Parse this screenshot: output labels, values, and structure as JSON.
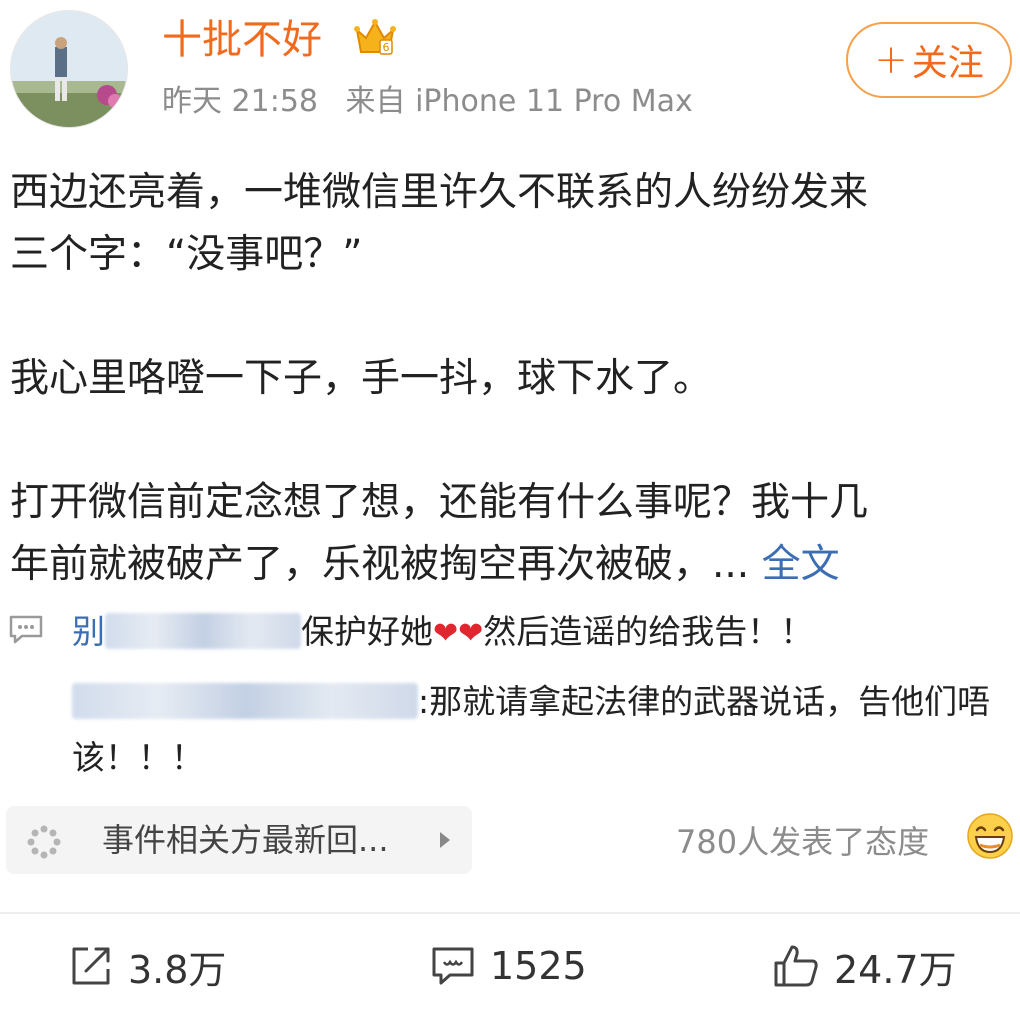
{
  "header": {
    "username": "十批不好",
    "time": "昨天 21:58",
    "source": "来自 iPhone 11 Pro Max",
    "follow_label": "关注",
    "follow_plus": "+"
  },
  "post": {
    "lines": [
      "西边还亮着，一堆微信里许久不联系的人纷纷发来",
      "三个字：“没事吧？”",
      "我心里咯噔一下子，手一抖，球下水了。",
      "打开微信前定念想了想，还能有什么事呢？我十几",
      "年前就被破产了，乐视被掏空再次被破，..."
    ],
    "full_text_link": "全文"
  },
  "comments": [
    {
      "author_prefix": "别",
      "text_before": "保护好她",
      "hearts": [
        "❤",
        "❤"
      ],
      "text_after": "然后造谣的给我告！！"
    },
    {
      "text": ":那就请拿起法律的武器说话，告他们唔该！！！"
    }
  ],
  "topic": {
    "label": "事件相关方最新回..."
  },
  "reactions": {
    "text": "780人发表了态度"
  },
  "actions": {
    "repost": "3.8万",
    "comments": "1525",
    "likes": "24.7万"
  },
  "colors": {
    "username": "#f26b1d",
    "link": "#3c6eb4",
    "meta": "#8c8c8c",
    "heart": "#e0262f"
  }
}
